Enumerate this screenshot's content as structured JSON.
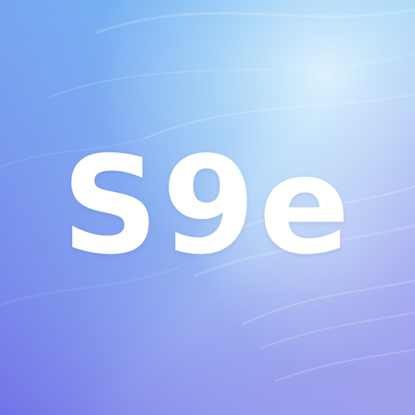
{
  "icon": {
    "logo_text": "S9e",
    "colors": {
      "top_left": "#6fb0f2",
      "center_light": "#b9e0fa",
      "bottom_left": "#7a78e8",
      "bottom_right": "#a5a2ee",
      "text": "#ffffff"
    }
  }
}
